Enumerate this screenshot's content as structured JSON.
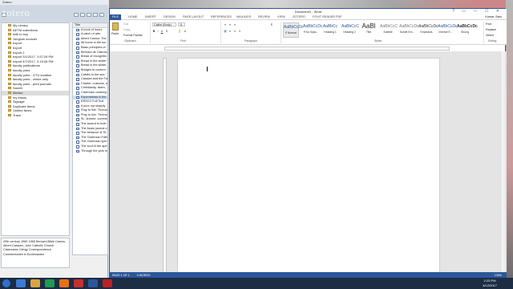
{
  "zotero": {
    "window_title": "Zotero",
    "logo": "zotero",
    "collections": [
      "My Library",
      "AETM collections",
      "with to buy",
      "Jonglum sources",
      "export",
      "export",
      "export 2",
      "export 3/1/2017, 1:57:26 PM",
      "export 4/7/2017, 2:15:08 PM",
      "faculty publications",
      "faculty pubs",
      "faculty pubs - GTU location",
      "faculty pubs - online only",
      "faculty pubs - print journals",
      "Sanchi",
      "Merton",
      "my thesis",
      "Signage",
      "Duplicate Items",
      "Unfiled Items",
      "Trash"
    ],
    "selected_collection": "Merton",
    "title_header": "Title",
    "items": [
      "A book of hours",
      "A catch of arts",
      "Albert Camus: The",
      "All home in the wo",
      "Basic principles of",
      "Bernard de Clairvau",
      "Bread of recognitio",
      "Bread in the wilder",
      "Bread in the wilder",
      "Bridges to contem",
      "Cables to the ace",
      "Cassian and the Fath",
      "Charter, customs, a",
      "Christianity, Islam,",
      "Cistercian contemp",
      "Experiments in the",
      "EBSCO Full Text",
      "If pure not sharply",
      "Pray to live: Thoma",
      "Pray to live: Thoma",
      "St. Jerome: comme",
      "The ascent to truth",
      "The Asian journal o",
      "The behavior of Tit",
      "The Cistercian Fath",
      "The Cistercian spiri",
      "The soul of the ape",
      "Through the year w"
    ],
    "tags_text": "20th century   1965   1965   Bernard   Bible   Camus, Albert   Cassian, John   Catholic Church   Cistercians   Clergy Correspondence   Commentaries in Ecclesiasten"
  },
  "word": {
    "window_title": "Document1 - Word",
    "window_controls": "? ▭ — ☐ ✕",
    "user": "Kumar, Bain",
    "tabs": [
      "FILE",
      "HOME",
      "INSERT",
      "DESIGN",
      "PAGE LAYOUT",
      "REFERENCES",
      "MAILINGS",
      "REVIEW",
      "VIEW",
      "ZOTERO",
      "FOXIT READER PDF"
    ],
    "clipboard": {
      "paste": "Paste",
      "cut": "Cut",
      "copy": "Copy",
      "format_painter": "Format Painter",
      "label": "Clipboard"
    },
    "font": {
      "name": "Calibri (Body)",
      "size": "11",
      "label": "Font"
    },
    "paragraph_label": "Paragraph",
    "styles_label": "Styles",
    "styles": [
      {
        "preview": "AaBbCcDc",
        "name": "¶ Normal"
      },
      {
        "preview": "AaBbCcDc",
        "name": "¶ No Spac..."
      },
      {
        "preview": "AaBbCc",
        "name": "Heading 1"
      },
      {
        "preview": "AaBbCcC",
        "name": "Heading 2"
      },
      {
        "preview": "AaBl",
        "name": "Title"
      },
      {
        "preview": "AaBbCcC",
        "name": "Subtitle"
      },
      {
        "preview": "AaBbCcDc",
        "name": "Subtle Em..."
      },
      {
        "preview": "AaBbCcDc",
        "name": "Emphasis"
      },
      {
        "preview": "AaBbCcDc",
        "name": "Intense E..."
      },
      {
        "preview": "AaBbCcDc",
        "name": "Strong"
      }
    ],
    "editing": {
      "find": "Find",
      "replace": "Replace",
      "select": "Select",
      "label": "Editing"
    },
    "status": {
      "page": "PAGE 1 OF 1",
      "words": "0 WORDS",
      "zoom": "100%"
    }
  },
  "taskbar": {
    "time": "2:25 PM",
    "date": "4/12/2017"
  }
}
